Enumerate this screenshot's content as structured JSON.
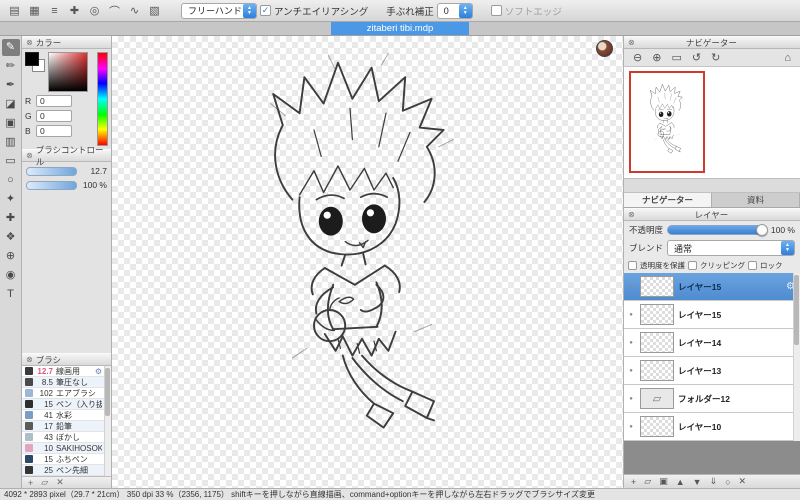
{
  "icons": {
    "close": "⊗",
    "gear": "⚙",
    "folder": "▱",
    "dot": "●",
    "check": "✓",
    "arrow_up": "▲",
    "arrow_down": "▼"
  },
  "colors": {
    "accent_blue": "#4a98e6",
    "selection_blue": "#5b9bd5",
    "viewport_red": "#d03a2a",
    "selected_brush_pink": "#e05585"
  },
  "window": {
    "doc_tab": "zitaberi tibi.mdp"
  },
  "top_toolbar": {
    "icons": [
      {
        "name": "grid-icon",
        "glyph": "▤"
      },
      {
        "name": "pixel-grid-icon",
        "glyph": "▦"
      },
      {
        "name": "parallel-snap-icon",
        "glyph": "≡"
      },
      {
        "name": "cross-snap-icon",
        "glyph": "✚"
      },
      {
        "name": "radial-snap-icon",
        "glyph": "◎"
      },
      {
        "name": "ellipse-snap-icon",
        "glyph": "⌒"
      },
      {
        "name": "curve-snap-icon",
        "glyph": "∿"
      },
      {
        "name": "snap-settings-icon",
        "glyph": "▧"
      }
    ],
    "tool_select_value": "フリーハンド",
    "antialias_label": "アンチエイリアシング",
    "antialias_checked": true,
    "stabilizer_label": "手ぶれ補正",
    "stabilizer_value": "0",
    "soft_edge_label": "ソフトエッジ",
    "soft_edge_checked": false
  },
  "tool_strip": {
    "tools": [
      {
        "name": "brush-tool",
        "glyph": "✎",
        "selected": true
      },
      {
        "name": "pencil-tool",
        "glyph": "✏"
      },
      {
        "name": "pen-tool",
        "glyph": "✒"
      },
      {
        "name": "eraser-tool",
        "glyph": "◪"
      },
      {
        "name": "fill-tool",
        "glyph": "▣"
      },
      {
        "name": "gradient-tool",
        "glyph": "▥"
      },
      {
        "name": "select-tool",
        "glyph": "▭"
      },
      {
        "name": "lasso-tool",
        "glyph": "○"
      },
      {
        "name": "magic-wand-tool",
        "glyph": "✦"
      },
      {
        "name": "move-tool",
        "glyph": "✚"
      },
      {
        "name": "hand-tool",
        "glyph": "❖"
      },
      {
        "name": "zoom-tool",
        "glyph": "⊕"
      },
      {
        "name": "eyedropper-tool",
        "glyph": "◉"
      },
      {
        "name": "text-tool",
        "glyph": "T"
      }
    ]
  },
  "color_panel": {
    "title": "カラー",
    "foreground": "#000000",
    "r_label": "R",
    "r_value": "0",
    "g_label": "G",
    "g_value": "0",
    "b_label": "B",
    "b_value": "0"
  },
  "brush_control": {
    "title": "ブラシコントロール",
    "size": "12.7",
    "opacity": "100 %"
  },
  "brush_panel": {
    "title": "ブラシ",
    "brushes": [
      {
        "size": "12.7",
        "name": "線画用",
        "swatch": "#3a3a3a",
        "selected": true
      },
      {
        "size": "8.5",
        "name": "筆圧なし",
        "swatch": "#4a4a4a"
      },
      {
        "size": "102",
        "name": "エアブラシ",
        "swatch": "#9db8d6"
      },
      {
        "size": "15",
        "name": "ペン（入り抜き",
        "swatch": "#2e2e2e"
      },
      {
        "size": "41",
        "name": "水彩",
        "swatch": "#7d9ec4"
      },
      {
        "size": "17",
        "name": "鉛筆",
        "swatch": "#5a5a5a"
      },
      {
        "size": "43",
        "name": "ぼかし",
        "swatch": "#aebdca"
      },
      {
        "size": "10",
        "name": "SAKIHOSOKU",
        "swatch": "#e0a6bd"
      },
      {
        "size": "15",
        "name": "ふちペン",
        "swatch": "#2c4a68"
      },
      {
        "size": "25",
        "name": "ペン先細",
        "swatch": "#353535"
      }
    ],
    "footer_icons": [
      {
        "name": "add-brush-icon",
        "glyph": "+"
      },
      {
        "name": "brush-folder-icon",
        "glyph": "▱"
      },
      {
        "name": "delete-brush-icon",
        "glyph": "✕"
      }
    ]
  },
  "navigator": {
    "title": "ナビゲーター",
    "icons": [
      {
        "name": "zoom-out-icon",
        "glyph": "⊖"
      },
      {
        "name": "zoom-in-icon",
        "glyph": "⊕"
      },
      {
        "name": "fit-window-icon",
        "glyph": "▭"
      },
      {
        "name": "rotate-ccw-icon",
        "glyph": "↺"
      },
      {
        "name": "rotate-cw-icon",
        "glyph": "↻"
      },
      {
        "name": "reset-view-icon",
        "glyph": "⌂"
      }
    ]
  },
  "side_tabs": {
    "tabs": [
      {
        "label": "ナビゲーター",
        "active": true
      },
      {
        "label": "資料",
        "active": false
      }
    ]
  },
  "layer_panel": {
    "title": "レイヤー",
    "opacity_label": "不透明度",
    "opacity_value": "100 %",
    "blend_label": "ブレンド",
    "blend_value": "通常",
    "protect_alpha_label": "透明度を保護",
    "clipping_label": "クリッピング",
    "lock_label": "ロック",
    "layers": [
      {
        "name": "レイヤー15",
        "type": "layer",
        "selected": true
      },
      {
        "name": "レイヤー15",
        "type": "layer"
      },
      {
        "name": "レイヤー14",
        "type": "layer"
      },
      {
        "name": "レイヤー13",
        "type": "layer"
      },
      {
        "name": "フォルダー12",
        "type": "folder"
      },
      {
        "name": "レイヤー10",
        "type": "layer"
      }
    ],
    "footer_icons": [
      {
        "name": "add-layer-icon",
        "glyph": "+"
      },
      {
        "name": "add-folder-icon",
        "glyph": "▱"
      },
      {
        "name": "duplicate-layer-icon",
        "glyph": "▣"
      },
      {
        "name": "move-layer-up-icon",
        "glyph": "▲"
      },
      {
        "name": "move-layer-down-icon",
        "glyph": "▼"
      },
      {
        "name": "merge-down-icon",
        "glyph": "⇓"
      },
      {
        "name": "clear-layer-icon",
        "glyph": "○"
      },
      {
        "name": "delete-layer-icon",
        "glyph": "✕"
      }
    ]
  },
  "status_bar": {
    "text": "4092 * 2893 pixel（29.7 * 21cm）  350 dpi  33 %（2356, 1175）   shiftキーを押しながら直線描画、command+optionキーを押しながら左右ドラッグでブラシサイズ変更"
  }
}
